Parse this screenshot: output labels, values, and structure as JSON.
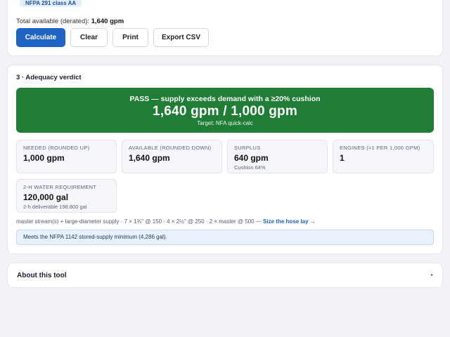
{
  "calc": {
    "badge": "NFPA 291 class AA",
    "total_label": "Total available (derated):",
    "total_value": "1,640 gpm",
    "buttons": {
      "calculate": "Calculate",
      "clear": "Clear",
      "print": "Print",
      "export": "Export CSV"
    }
  },
  "verdict": {
    "section_title": "3 · Adequacy verdict",
    "status_line": "PASS — supply exceeds demand with a ≥20% cushion",
    "ratio": "1,640 gpm / 1,000 gpm",
    "target": "Target: NFA quick-calc",
    "stats": [
      {
        "label": "NEEDED (ROUNDED UP)",
        "value": "1,000 gpm",
        "sub": ""
      },
      {
        "label": "AVAILABLE (ROUNDED DOWN)",
        "value": "1,640 gpm",
        "sub": ""
      },
      {
        "label": "SURPLUS",
        "value": "640 gpm",
        "sub": "Cushion 64%"
      },
      {
        "label": "ENGINES (≈1 PER 1,000 GPM)",
        "value": "1",
        "sub": ""
      },
      {
        "label": "2-H WATER REQUIREMENT",
        "value": "120,000 gal",
        "sub": "2-h deliverable 196,800 gal"
      }
    ],
    "note_text": "master stream(s) + large-diameter supply · 7 × 1¾\" @ 150 · 4 × 2½\" @ 250 · 2 × master @ 500 —",
    "note_link": "Size the hose lay →",
    "info": "Meets the NFPA 1142 stored-supply minimum (4,286 gal)."
  },
  "about": {
    "title": "About this tool",
    "chevron": "▸"
  },
  "colors": {
    "primary": "#1f63c4",
    "pass": "#1f7d35",
    "info_bg": "#e8f1fc"
  }
}
